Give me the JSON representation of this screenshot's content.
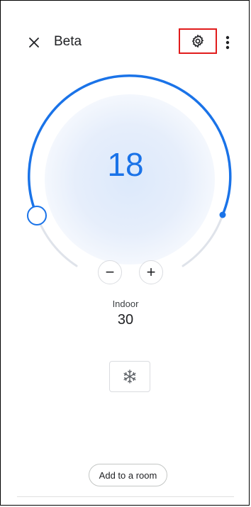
{
  "header": {
    "title": "Beta",
    "close_icon": "close-icon",
    "settings_icon": "gear-icon",
    "more_icon": "more-vert-icon"
  },
  "thermostat": {
    "setpoint": "18",
    "minus_label": "−",
    "plus_label": "+",
    "indoor_label": "Indoor",
    "indoor_value": "30",
    "mode_icon": "snowflake-icon"
  },
  "actions": {
    "add_to_room": "Add to a room"
  },
  "colors": {
    "accent": "#1a73e8",
    "track": "#dfe3ea",
    "highlight_box": "#e11c1c",
    "glow": "#dce9fb"
  }
}
